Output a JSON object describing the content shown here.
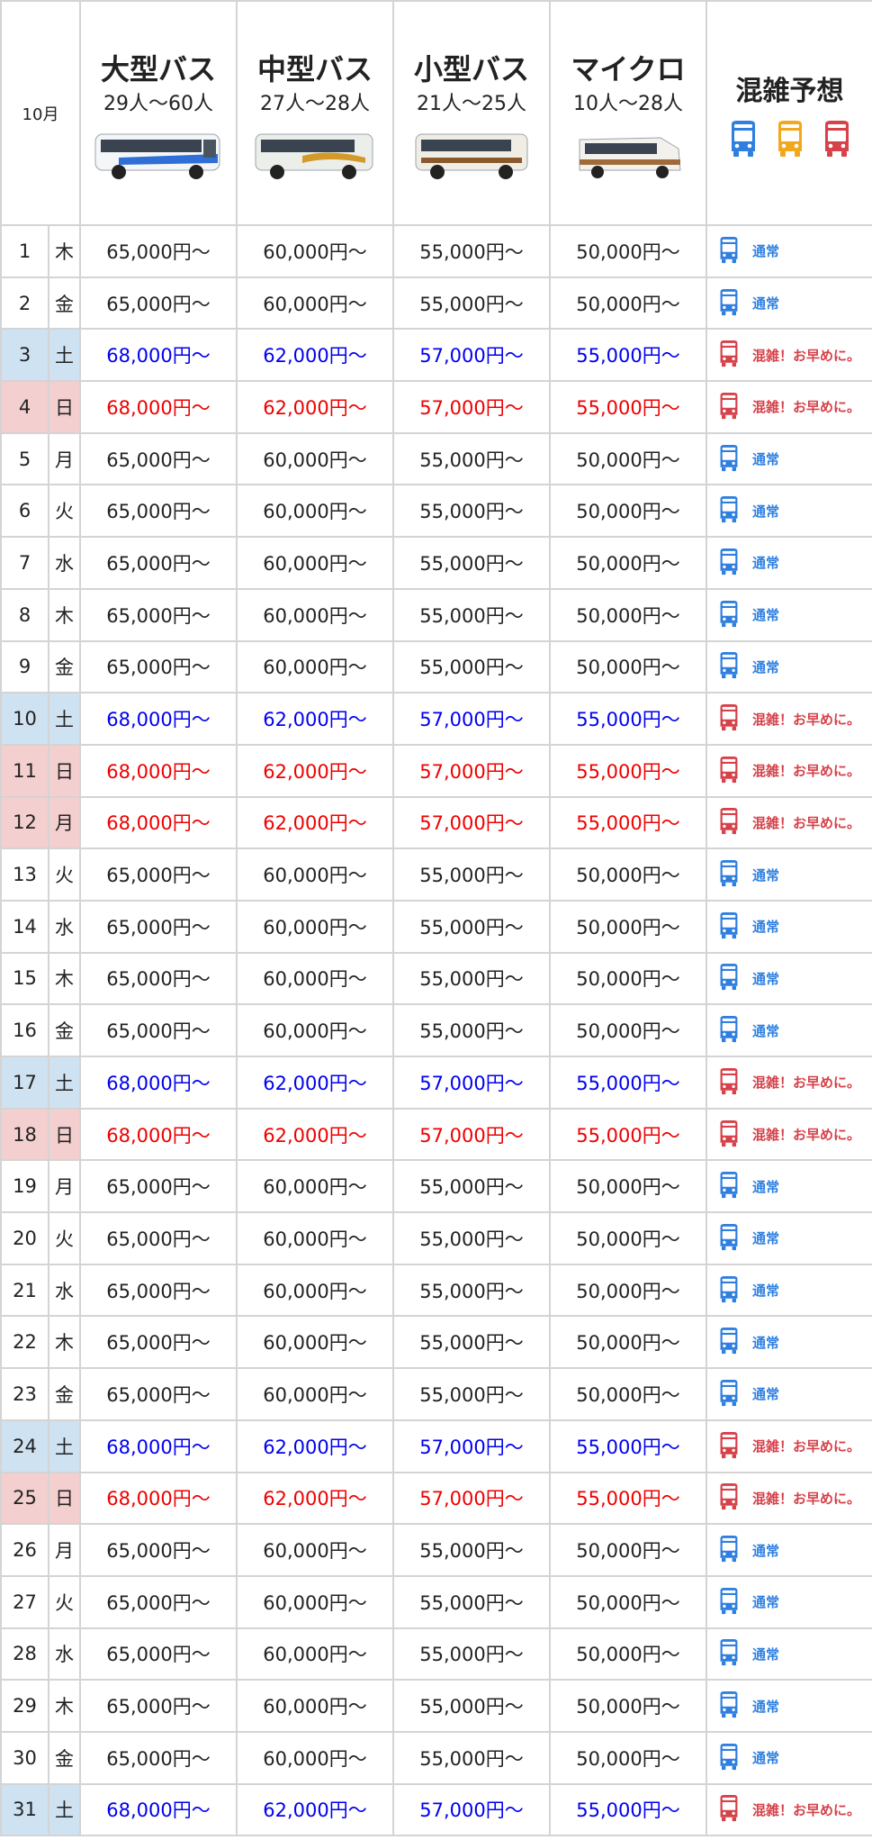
{
  "header": {
    "month": "10月",
    "buses": [
      {
        "name": "大型バス",
        "capacity": "29人〜60人"
      },
      {
        "name": "中型バス",
        "capacity": "27人〜28人"
      },
      {
        "name": "小型バス",
        "capacity": "21人〜25人"
      },
      {
        "name": "マイクロ",
        "capacity": "10人〜28人"
      }
    ],
    "congestion_title": "混雑予想"
  },
  "colors": {
    "weekday_text": "#222222",
    "saturday_text": "#0000ee",
    "sunday_text": "#ee0000",
    "saturday_bg": "#cfe2f2",
    "sunday_bg": "#f4cfcf",
    "normal_icon": "#2e7fe0",
    "medium_icon": "#f2a81d",
    "busy_icon": "#d6414a"
  },
  "icons": {
    "bus_normal": "bus-blue-icon",
    "bus_medium": "bus-yellow-icon",
    "bus_busy": "bus-red-icon"
  },
  "rows": [
    {
      "day": "1",
      "dow": "木",
      "type": "weekday",
      "prices": [
        "65,000円〜",
        "60,000円〜",
        "55,000円〜",
        "50,000円〜"
      ],
      "congestion": "通常",
      "level": "normal"
    },
    {
      "day": "2",
      "dow": "金",
      "type": "weekday",
      "prices": [
        "65,000円〜",
        "60,000円〜",
        "55,000円〜",
        "50,000円〜"
      ],
      "congestion": "通常",
      "level": "normal"
    },
    {
      "day": "3",
      "dow": "土",
      "type": "sat",
      "prices": [
        "68,000円〜",
        "62,000円〜",
        "57,000円〜",
        "55,000円〜"
      ],
      "congestion": "混雑！お早めに。",
      "level": "busy"
    },
    {
      "day": "4",
      "dow": "日",
      "type": "sun",
      "prices": [
        "68,000円〜",
        "62,000円〜",
        "57,000円〜",
        "55,000円〜"
      ],
      "congestion": "混雑！お早めに。",
      "level": "busy"
    },
    {
      "day": "5",
      "dow": "月",
      "type": "weekday",
      "prices": [
        "65,000円〜",
        "60,000円〜",
        "55,000円〜",
        "50,000円〜"
      ],
      "congestion": "通常",
      "level": "normal"
    },
    {
      "day": "6",
      "dow": "火",
      "type": "weekday",
      "prices": [
        "65,000円〜",
        "60,000円〜",
        "55,000円〜",
        "50,000円〜"
      ],
      "congestion": "通常",
      "level": "normal"
    },
    {
      "day": "7",
      "dow": "水",
      "type": "weekday",
      "prices": [
        "65,000円〜",
        "60,000円〜",
        "55,000円〜",
        "50,000円〜"
      ],
      "congestion": "通常",
      "level": "normal"
    },
    {
      "day": "8",
      "dow": "木",
      "type": "weekday",
      "prices": [
        "65,000円〜",
        "60,000円〜",
        "55,000円〜",
        "50,000円〜"
      ],
      "congestion": "通常",
      "level": "normal"
    },
    {
      "day": "9",
      "dow": "金",
      "type": "weekday",
      "prices": [
        "65,000円〜",
        "60,000円〜",
        "55,000円〜",
        "50,000円〜"
      ],
      "congestion": "通常",
      "level": "normal"
    },
    {
      "day": "10",
      "dow": "土",
      "type": "sat",
      "prices": [
        "68,000円〜",
        "62,000円〜",
        "57,000円〜",
        "55,000円〜"
      ],
      "congestion": "混雑！お早めに。",
      "level": "busy"
    },
    {
      "day": "11",
      "dow": "日",
      "type": "sun",
      "prices": [
        "68,000円〜",
        "62,000円〜",
        "57,000円〜",
        "55,000円〜"
      ],
      "congestion": "混雑！お早めに。",
      "level": "busy"
    },
    {
      "day": "12",
      "dow": "月",
      "type": "sun",
      "prices": [
        "68,000円〜",
        "62,000円〜",
        "57,000円〜",
        "55,000円〜"
      ],
      "congestion": "混雑！お早めに。",
      "level": "busy"
    },
    {
      "day": "13",
      "dow": "火",
      "type": "weekday",
      "prices": [
        "65,000円〜",
        "60,000円〜",
        "55,000円〜",
        "50,000円〜"
      ],
      "congestion": "通常",
      "level": "normal"
    },
    {
      "day": "14",
      "dow": "水",
      "type": "weekday",
      "prices": [
        "65,000円〜",
        "60,000円〜",
        "55,000円〜",
        "50,000円〜"
      ],
      "congestion": "通常",
      "level": "normal"
    },
    {
      "day": "15",
      "dow": "木",
      "type": "weekday",
      "prices": [
        "65,000円〜",
        "60,000円〜",
        "55,000円〜",
        "50,000円〜"
      ],
      "congestion": "通常",
      "level": "normal"
    },
    {
      "day": "16",
      "dow": "金",
      "type": "weekday",
      "prices": [
        "65,000円〜",
        "60,000円〜",
        "55,000円〜",
        "50,000円〜"
      ],
      "congestion": "通常",
      "level": "normal"
    },
    {
      "day": "17",
      "dow": "土",
      "type": "sat",
      "prices": [
        "68,000円〜",
        "62,000円〜",
        "57,000円〜",
        "55,000円〜"
      ],
      "congestion": "混雑！お早めに。",
      "level": "busy"
    },
    {
      "day": "18",
      "dow": "日",
      "type": "sun",
      "prices": [
        "68,000円〜",
        "62,000円〜",
        "57,000円〜",
        "55,000円〜"
      ],
      "congestion": "混雑！お早めに。",
      "level": "busy"
    },
    {
      "day": "19",
      "dow": "月",
      "type": "weekday",
      "prices": [
        "65,000円〜",
        "60,000円〜",
        "55,000円〜",
        "50,000円〜"
      ],
      "congestion": "通常",
      "level": "normal"
    },
    {
      "day": "20",
      "dow": "火",
      "type": "weekday",
      "prices": [
        "65,000円〜",
        "60,000円〜",
        "55,000円〜",
        "50,000円〜"
      ],
      "congestion": "通常",
      "level": "normal"
    },
    {
      "day": "21",
      "dow": "水",
      "type": "weekday",
      "prices": [
        "65,000円〜",
        "60,000円〜",
        "55,000円〜",
        "50,000円〜"
      ],
      "congestion": "通常",
      "level": "normal"
    },
    {
      "day": "22",
      "dow": "木",
      "type": "weekday",
      "prices": [
        "65,000円〜",
        "60,000円〜",
        "55,000円〜",
        "50,000円〜"
      ],
      "congestion": "通常",
      "level": "normal"
    },
    {
      "day": "23",
      "dow": "金",
      "type": "weekday",
      "prices": [
        "65,000円〜",
        "60,000円〜",
        "55,000円〜",
        "50,000円〜"
      ],
      "congestion": "通常",
      "level": "normal"
    },
    {
      "day": "24",
      "dow": "土",
      "type": "sat",
      "prices": [
        "68,000円〜",
        "62,000円〜",
        "57,000円〜",
        "55,000円〜"
      ],
      "congestion": "混雑！お早めに。",
      "level": "busy"
    },
    {
      "day": "25",
      "dow": "日",
      "type": "sun",
      "prices": [
        "68,000円〜",
        "62,000円〜",
        "57,000円〜",
        "55,000円〜"
      ],
      "congestion": "混雑！お早めに。",
      "level": "busy"
    },
    {
      "day": "26",
      "dow": "月",
      "type": "weekday",
      "prices": [
        "65,000円〜",
        "60,000円〜",
        "55,000円〜",
        "50,000円〜"
      ],
      "congestion": "通常",
      "level": "normal"
    },
    {
      "day": "27",
      "dow": "火",
      "type": "weekday",
      "prices": [
        "65,000円〜",
        "60,000円〜",
        "55,000円〜",
        "50,000円〜"
      ],
      "congestion": "通常",
      "level": "normal"
    },
    {
      "day": "28",
      "dow": "水",
      "type": "weekday",
      "prices": [
        "65,000円〜",
        "60,000円〜",
        "55,000円〜",
        "50,000円〜"
      ],
      "congestion": "通常",
      "level": "normal"
    },
    {
      "day": "29",
      "dow": "木",
      "type": "weekday",
      "prices": [
        "65,000円〜",
        "60,000円〜",
        "55,000円〜",
        "50,000円〜"
      ],
      "congestion": "通常",
      "level": "normal"
    },
    {
      "day": "30",
      "dow": "金",
      "type": "weekday",
      "prices": [
        "65,000円〜",
        "60,000円〜",
        "55,000円〜",
        "50,000円〜"
      ],
      "congestion": "通常",
      "level": "normal"
    },
    {
      "day": "31",
      "dow": "土",
      "type": "sat",
      "prices": [
        "68,000円〜",
        "62,000円〜",
        "57,000円〜",
        "55,000円〜"
      ],
      "congestion": "混雑！お早めに。",
      "level": "busy"
    }
  ]
}
